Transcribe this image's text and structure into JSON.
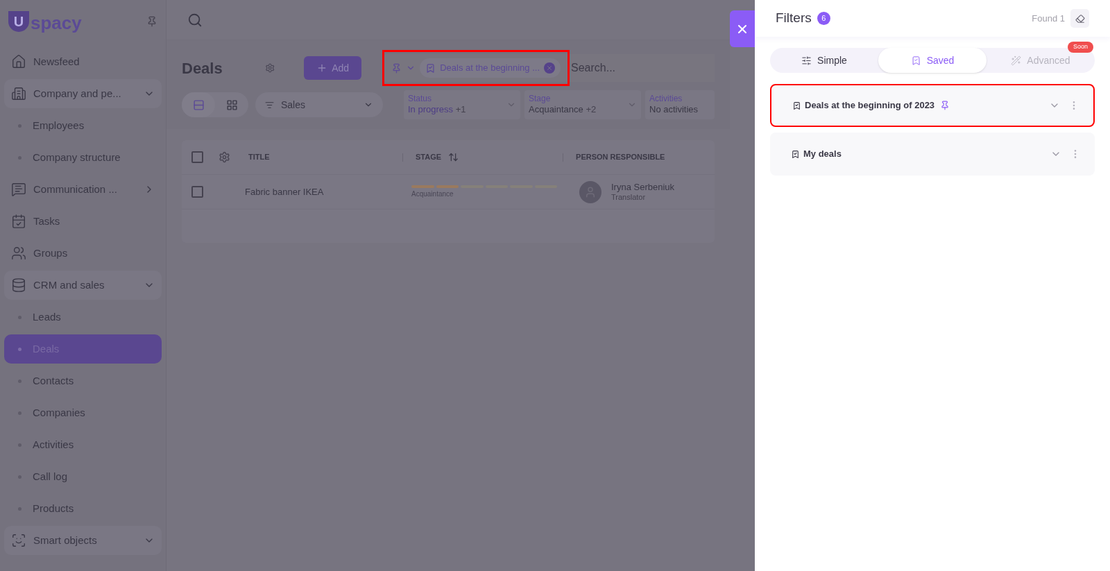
{
  "sidebar": {
    "logo": {
      "mark": "U",
      "text": "spacy"
    },
    "items": [
      {
        "label": "Newsfeed",
        "kind": "link",
        "selected": false
      },
      {
        "label": "Company and pe...",
        "kind": "group",
        "expanded": true,
        "children": [
          {
            "label": "Employees",
            "selected": false
          },
          {
            "label": "Company structure",
            "selected": false
          }
        ]
      },
      {
        "label": "Communication ...",
        "kind": "group",
        "expanded": false
      },
      {
        "label": "Tasks",
        "kind": "link",
        "selected": false
      },
      {
        "label": "Groups",
        "kind": "link",
        "selected": false
      },
      {
        "label": "CRM and sales",
        "kind": "group",
        "expanded": true,
        "children": [
          {
            "label": "Leads",
            "selected": false
          },
          {
            "label": "Deals",
            "selected": true
          },
          {
            "label": "Contacts",
            "selected": false
          },
          {
            "label": "Companies",
            "selected": false
          },
          {
            "label": "Activities",
            "selected": false
          },
          {
            "label": "Call log",
            "selected": false
          },
          {
            "label": "Products",
            "selected": false
          }
        ]
      },
      {
        "label": "Smart objects",
        "kind": "group",
        "expanded": true
      }
    ]
  },
  "page": {
    "title": "Deals",
    "add_button": "Add",
    "filter_chip": {
      "label": "Deals at the beginning ...",
      "highlighted": true
    },
    "search": {
      "placeholder": "Search..."
    },
    "views": [
      {
        "kind": "list",
        "selected": true
      },
      {
        "kind": "grid",
        "selected": false
      }
    ],
    "pipeline": "Sales",
    "filters": [
      {
        "label": "Status",
        "value": "In progress",
        "extra": "+1"
      },
      {
        "label": "Stage",
        "value": "Acquaintance",
        "extra": "+2"
      },
      {
        "label": "Activities",
        "value": "No activities"
      }
    ]
  },
  "table": {
    "all_checked": false,
    "columns": [
      "TITLE",
      "STAGE",
      "PERSON RESPONSIBLE"
    ],
    "rows": [
      {
        "checked": false,
        "title": "Fabric banner IKEA",
        "stage": "Acquaintance",
        "segments": [
          {
            "filled": true
          },
          {
            "filled": true
          },
          {
            "filled": false
          },
          {
            "filled": false
          },
          {
            "filled": false
          },
          {
            "filled": false
          }
        ],
        "person": "Iryna Serbeniuk",
        "role": "Translator"
      }
    ]
  },
  "drawer": {
    "title": "Filters",
    "count": "6",
    "found": "Found 1",
    "tabs": [
      {
        "label": "Simple",
        "kind": "simple",
        "selected": false,
        "disabled": false
      },
      {
        "label": "Saved",
        "kind": "saved",
        "selected": true,
        "disabled": false
      },
      {
        "label": "Advanced",
        "kind": "advanced",
        "selected": false,
        "disabled": true,
        "badge": "Soon"
      }
    ],
    "saved_filters": [
      {
        "label": "Deals at the beginning of 2023",
        "pinned": true,
        "highlighted": true
      },
      {
        "label": "My deals",
        "pinned": false,
        "highlighted": false
      }
    ]
  }
}
